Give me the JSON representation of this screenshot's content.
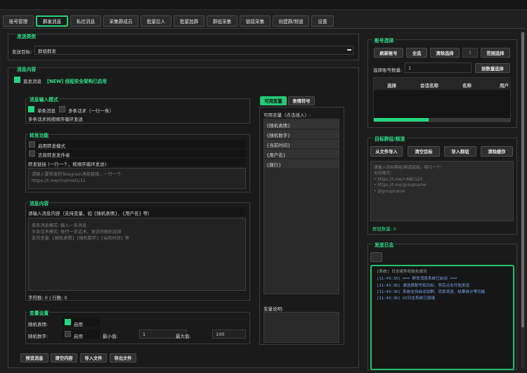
{
  "tabs": [
    {
      "label": "账号管理",
      "active": false
    },
    {
      "label": "群发消息",
      "active": true
    },
    {
      "label": "私信消息",
      "active": false
    },
    {
      "label": "采集群成员",
      "active": false
    },
    {
      "label": "批量拉人",
      "active": false
    },
    {
      "label": "批量加群",
      "active": false
    },
    {
      "label": "群组采集",
      "active": false
    },
    {
      "label": "链接采集",
      "active": false
    },
    {
      "label": "创建群/频道",
      "active": false
    },
    {
      "label": "设置",
      "active": false
    }
  ],
  "send_type": {
    "title": "发送类型",
    "target_label": "发送目标:",
    "target_value": "群组群发"
  },
  "message": {
    "title": "消息内容",
    "direct_label": "直发消息",
    "direct_note": "[NEW] 线程安全架构已启用",
    "input_mode": {
      "title": "消息输入模式",
      "single_label": "单条消息",
      "multi_label": "多条话术（一行一条）",
      "hint": "多条话术将按顺序循环发送"
    },
    "forward": {
      "title": "转发功能",
      "enable_label": "启用转发模式",
      "remove_sender_label": "去除转发发件者",
      "link_label": "转发链接 (一行一个，按顺序循环发送):",
      "placeholder": "请输入要转发的Telegram消息链接，一行一个:\nhttps://t.me/channel1/11"
    },
    "content": {
      "title": "消息内容",
      "hint": "请输入消息内容（支持变量，如 {随机表情}、{用户名} 等）",
      "placeholder": "单条消息模式: 输入一条消息\n多条话术模式: 每行一条话术，发送时随机选择\n支持变量: {随机表情} {随机数字} {当前时间} 等",
      "counter": "字符数: 0 | 行数: 0"
    },
    "variables": {
      "title": "变量设置",
      "emoji_label": "随机表情:",
      "emoji_enable": "启用",
      "number_label": "随机数字:",
      "number_enable": "启用",
      "min_label": "最小值:",
      "min_value": "1",
      "max_label": "最大值:",
      "max_value": "100"
    },
    "buttons": [
      "预览消息",
      "清空内容",
      "导入文件",
      "导出文件"
    ]
  },
  "vars_panel": {
    "tab_vars": "可用变量",
    "tab_emoji": "表情符号",
    "list_title": "可用变量（点击插入）:",
    "items": [
      "{随机表情}",
      "{随机数字}",
      "{当前时间}",
      "{用户名}",
      "{换行}"
    ],
    "desc_label": "变量说明:"
  },
  "accounts": {
    "title": "账号选择",
    "buttons": [
      "刷新账号",
      "全选",
      "清除选择",
      "1",
      "范围选择"
    ],
    "count_label": "选择账号数量:",
    "count_value": "1",
    "count_button": "按数量选择",
    "columns": [
      "选择",
      "会话名称",
      "名称",
      "用户"
    ]
  },
  "targets": {
    "title": "目标群组/频道",
    "buttons": [
      "从文件导入",
      "清空目标",
      "导入群组",
      "清除缓存"
    ],
    "placeholder": "请输入目标群组/频道链接，每行一个:\n支持格式:\n• https://t.me/+ABC123\n• https://t.me/groupname\n• @groupname",
    "count": "群组数量: 0"
  },
  "send_log": {
    "title": "发送日志",
    "lines": [
      "[系统] 日志组件初始化成功",
      "[11:43:36] === 群发消息系统已启动 ===",
      "[11:43:36] 请选择账号和目标，然后点击开始发送",
      "[11:43:36] 系统支持自动加群、消息发送、结果统计等功能",
      "[11:43:36] UI日志系统已就绪"
    ]
  },
  "colors": {
    "accent": "#26d07c",
    "bg": "#202020",
    "panel": "#1a1a1a"
  }
}
